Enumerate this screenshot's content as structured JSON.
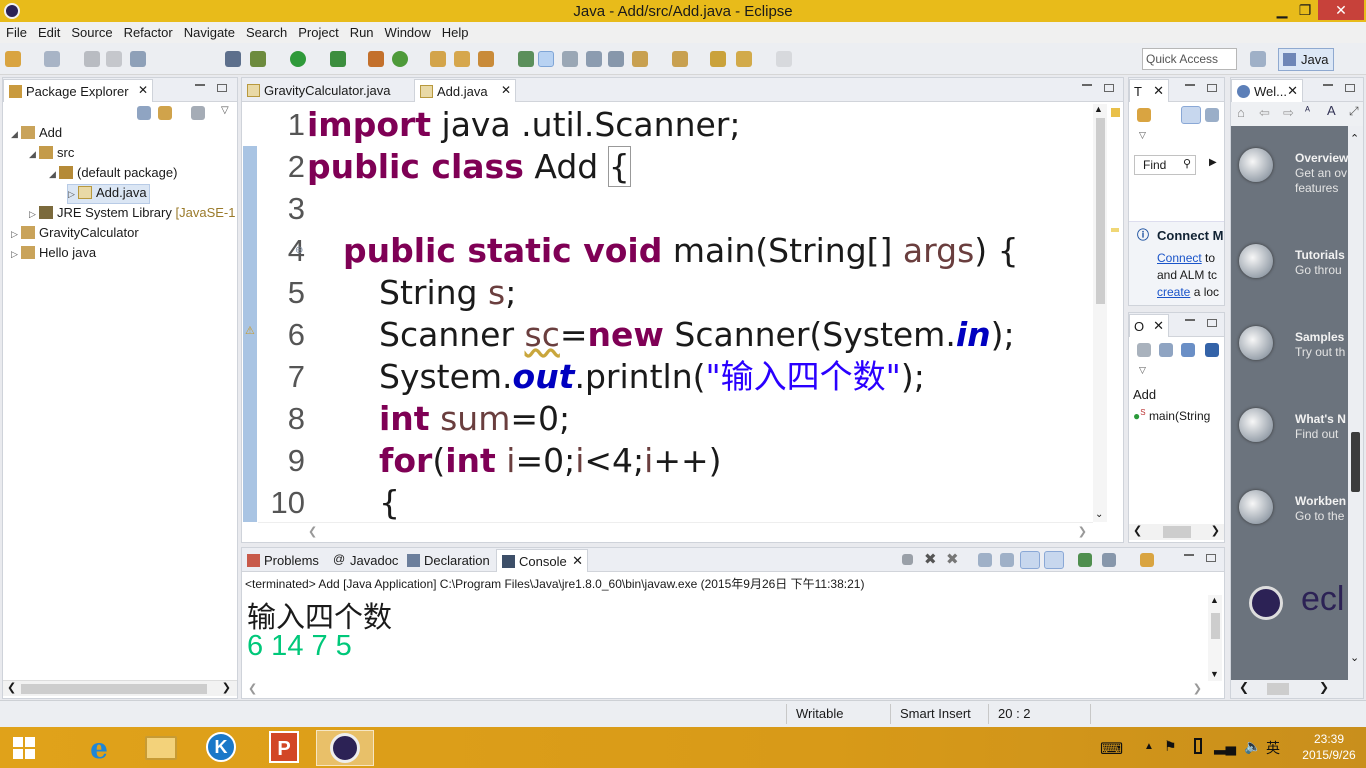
{
  "window": {
    "title": "Java - Add/src/Add.java - Eclipse",
    "close": "✕",
    "maximize": "❐",
    "minimize": "▁"
  },
  "menu": [
    "File",
    "Edit",
    "Source",
    "Refactor",
    "Navigate",
    "Search",
    "Project",
    "Run",
    "Window",
    "Help"
  ],
  "toolbar": {
    "quick_access": "Quick Access",
    "perspective": "Java"
  },
  "package_explorer": {
    "title": "Package Explorer",
    "items": [
      {
        "label": "Add",
        "expanded": true
      },
      {
        "label": "src",
        "expanded": true
      },
      {
        "label": "(default package)",
        "expanded": true
      },
      {
        "label": "Add.java",
        "selected": true
      },
      {
        "label": "JRE System Library",
        "suffix": "[JavaSE-1"
      },
      {
        "label": "GravityCalculator"
      },
      {
        "label": "Hello java"
      }
    ]
  },
  "editor": {
    "tabs": [
      {
        "label": "GravityCalculator.java",
        "active": false
      },
      {
        "label": "Add.java",
        "active": true
      }
    ],
    "lines": [
      {
        "n": "1"
      },
      {
        "n": "2"
      },
      {
        "n": "3"
      },
      {
        "n": "4"
      },
      {
        "n": "5"
      },
      {
        "n": "6"
      },
      {
        "n": "7"
      },
      {
        "n": "8"
      },
      {
        "n": "9"
      },
      {
        "n": "10"
      }
    ],
    "code": {
      "l1_kw": "import",
      "l1_rest": " java .util.Scanner;",
      "l2_kw": "public class",
      "l2_rest": " Add ",
      "l2_brace": "{",
      "l4_kw": "public static void",
      "l4_rest": " main(String[] ",
      "l4_var": "args",
      "l4_end": ") {",
      "l5_type": "String ",
      "l5_var": "s",
      "l5_end": ";",
      "l6_type": "Scanner ",
      "l6_var": "sc",
      "l6_eq": "=",
      "l6_kw": "new",
      "l6_rest": " Scanner(System.",
      "l6_st": "in",
      "l6_end": ");",
      "l7_a": "System.",
      "l7_st": "out",
      "l7_b": ".println(",
      "l7_str": "\"输入四个数\"",
      "l7_end": ");",
      "l8_kw": "int",
      "l8_rest": " ",
      "l8_var": "sum",
      "l8_end": "=0;",
      "l9_kw": "for",
      "l9_a": "(",
      "l9_kw2": "int",
      "l9_b": " ",
      "l9_var": "i",
      "l9_c": "=0;",
      "l9_var2": "i",
      "l9_d": "<4;",
      "l9_var3": "i",
      "l9_e": "++)",
      "l10": "{"
    }
  },
  "task_list": {
    "title": "T",
    "find": "Find",
    "connect_title": "Connect M",
    "connect_link": "Connect",
    "connect_to": " to",
    "connect_alm": "and ALM tc",
    "create_link": "create",
    "create_rest": " a loc"
  },
  "outline": {
    "title": "O",
    "root": "Add",
    "method": "main(String"
  },
  "console": {
    "tabs": [
      "Problems",
      "Javadoc",
      "Declaration",
      "Console"
    ],
    "header": "<terminated> Add [Java Application] C:\\Program Files\\Java\\jre1.8.0_60\\bin\\javaw.exe (2015年9月26日 下午11:38:21)",
    "output_line1": "输入四个数",
    "output_line2": "6 14 7 5",
    "input_color": "#00c87a"
  },
  "welcome": {
    "tab": "Wel...",
    "items": [
      {
        "title": "Overview",
        "sub1": "Get an ov",
        "sub2": "features"
      },
      {
        "title": "Tutorials",
        "sub1": "Go throu"
      },
      {
        "title": "Samples",
        "sub1": "Try out th"
      },
      {
        "title": "What's N",
        "sub1": "Find out"
      },
      {
        "title": "Workben",
        "sub1": "Go to the"
      }
    ],
    "logo": "ecl"
  },
  "status": {
    "writable": "Writable",
    "insert": "Smart Insert",
    "position": "20 : 2"
  },
  "taskbar": {
    "time": "23:39",
    "date": "2015/9/26",
    "ime": "英"
  },
  "colors": {
    "titlebar": "#e8bb1a",
    "keyword": "#7f0055",
    "string": "#2a00ff",
    "static": "#0000c0",
    "welcome_bg": "#6b737d",
    "taskbar": "#dca01a"
  }
}
